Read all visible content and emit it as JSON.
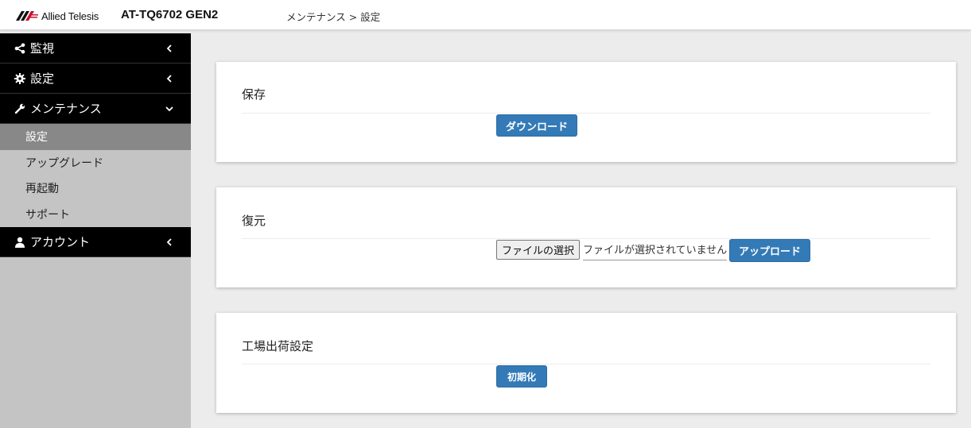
{
  "header": {
    "brand": "Allied Telesis",
    "model": "AT-TQ6702 GEN2",
    "breadcrumb": "メンテナンス > 設定"
  },
  "sidebar": {
    "items": [
      {
        "label": "監視",
        "icon": "share-icon"
      },
      {
        "label": "設定",
        "icon": "gear-icon"
      },
      {
        "label": "メンテナンス",
        "icon": "wrench-icon"
      },
      {
        "label": "アカウント",
        "icon": "user-icon"
      }
    ],
    "sub_items": [
      {
        "label": "設定",
        "active": true
      },
      {
        "label": "アップグレード"
      },
      {
        "label": "再起動"
      },
      {
        "label": "サポート"
      }
    ]
  },
  "cards": {
    "save": {
      "title": "保存",
      "button": "ダウンロード"
    },
    "restore": {
      "title": "復元",
      "file_button": "ファイルの選択",
      "file_status": "ファイルが選択されていません",
      "button": "アップロード"
    },
    "factory": {
      "title": "工場出荷設定",
      "button": "初期化"
    }
  },
  "colors": {
    "accent": "#337ab7",
    "nav_bg": "#000000",
    "sidebar_bg": "#c4c4c4",
    "active_sub_bg": "#888888",
    "page_bg": "#ececec"
  }
}
